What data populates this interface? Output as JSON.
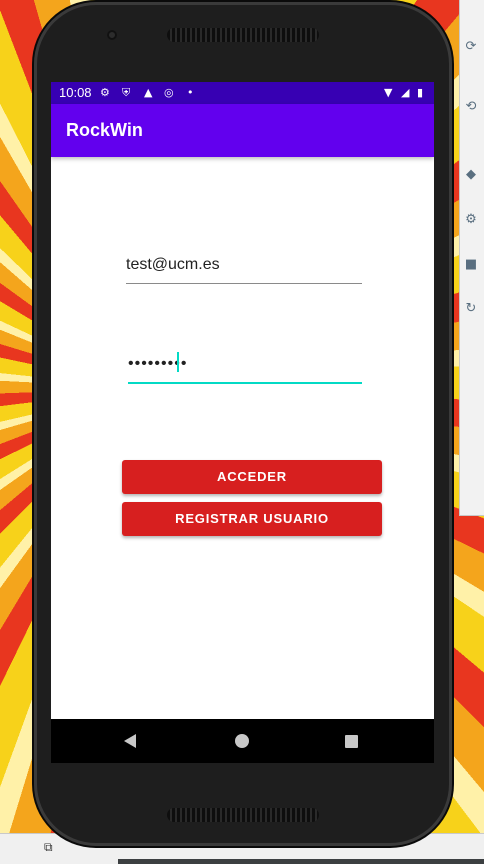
{
  "status_bar": {
    "time": "10:08",
    "icons": [
      "settings-icon",
      "shield-icon",
      "sim-icon",
      "at-icon",
      "dot-icon",
      "wifi-icon",
      "signal-icon",
      "battery-icon"
    ]
  },
  "app_bar": {
    "title": "RockWin"
  },
  "login": {
    "email_value": "test@ucm.es",
    "password_value": "•••••••••",
    "accent_color": "#03dac5"
  },
  "buttons": {
    "acceder_label": "ACCEDER",
    "registrar_label": "REGISTRAR USUARIO",
    "color": "#d71f1f"
  },
  "nav_bar": {
    "icons": [
      "back-icon",
      "home-icon",
      "recents-icon"
    ]
  },
  "colors": {
    "primary": "#6200ee",
    "primary_dark": "#3700b3"
  }
}
